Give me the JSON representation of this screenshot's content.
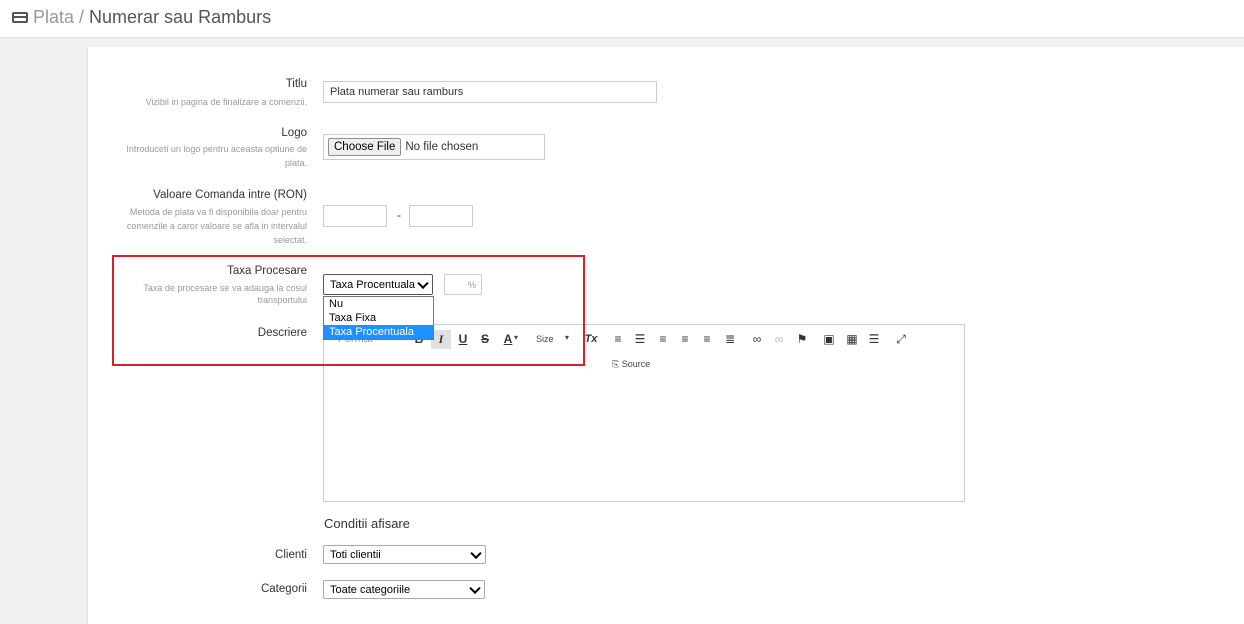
{
  "breadcrumb": {
    "parent": "Plata",
    "separator": "/",
    "current": "Numerar sau Ramburs",
    "icon": "credit-card-icon"
  },
  "form": {
    "title": {
      "label": "Titlu",
      "hint": "Vizibil in pagina de finalizare a comenzii.",
      "value": "Plata numerar sau ramburs"
    },
    "logo": {
      "label": "Logo",
      "hint_1": "Introduceti un logo pentru aceasta optiune de",
      "hint_2": "plata.",
      "button": "Choose File",
      "status": "No file chosen"
    },
    "order_value": {
      "label": "Valoare Comanda intre (RON)",
      "hint_1": "Metoda de plata va fi disponibila doar pentru",
      "hint_2": "comenzile a caror valoare se afla in intervalul",
      "hint_3": "selectat.",
      "separator": "-",
      "min": "",
      "max": ""
    },
    "processing_fee": {
      "label": "Taxa Procesare",
      "hint_1": "Taxa de procesare se va adauga la cosul",
      "hint_2": "transportului",
      "selected": "Taxa Procentuala",
      "options": [
        "Nu",
        "Taxa Fixa",
        "Taxa Procentuala"
      ],
      "unit_placeholder": "%"
    },
    "description": {
      "label": "Descriere"
    },
    "display_conditions": {
      "title": "Conditii afisare"
    },
    "clients": {
      "label": "Clienti",
      "selected": "Toti clientii"
    },
    "categories": {
      "label": "Categorii",
      "selected": "Toate categoriile"
    }
  },
  "editor_toolbar": {
    "format": "Format",
    "size": "Size",
    "source": "Source",
    "bold": "B",
    "italic": "I",
    "underline": "U",
    "strike": "S",
    "text_color": "A",
    "remove_format": "Tx"
  },
  "colors": {
    "highlight": "#d9212a",
    "selected_option": "#1e90ff"
  }
}
